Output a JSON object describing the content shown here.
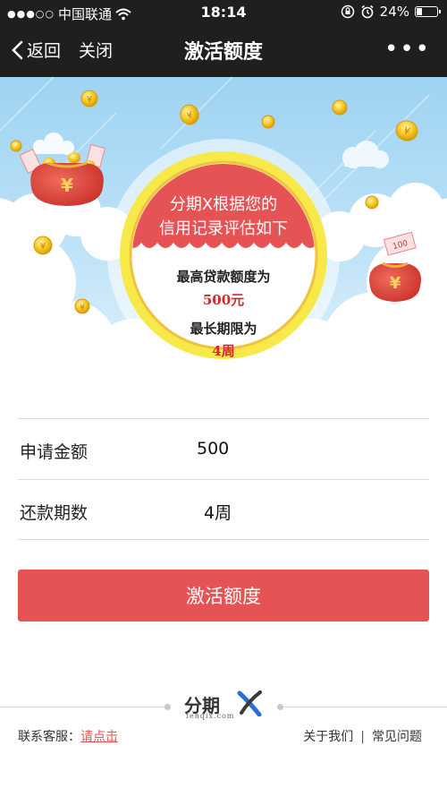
{
  "status_bar": {
    "carrier": "中国联通",
    "time": "18:14",
    "battery_text": "24%",
    "battery_level": 0.24
  },
  "nav": {
    "back_label": "返回",
    "close_label": "关闭",
    "title": "激活额度",
    "more_label": "•••"
  },
  "banner": {
    "heading_line1": "分期X根据您的",
    "heading_line2": "信用记录评估如下",
    "limit_label": "最高贷款额度为",
    "limit_value": "500元",
    "period_label": "最长期限为",
    "period_value": "4周",
    "bag_symbol": "¥",
    "note_value": "100"
  },
  "form": {
    "amount_label": "申请金额",
    "amount_value": "500",
    "period_label": "还款期数",
    "period_value": "4周"
  },
  "activate_button": "激活额度",
  "footer": {
    "logo_text": "分期",
    "logo_sub": "fenqix.com",
    "contact_label": "联系客服：",
    "contact_link": "请点击",
    "about_link": "关于我们",
    "separator": "|",
    "faq_link": "常见问题"
  },
  "colors": {
    "accent_red": "#e55355",
    "nav_bg": "#1f1f1f",
    "coin_gold": "#f5c51c",
    "ring_yellow": "#f7e94a"
  }
}
